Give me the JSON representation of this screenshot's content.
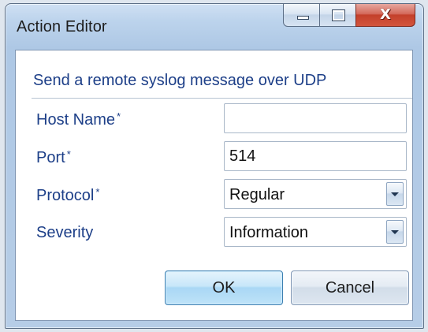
{
  "window": {
    "title": "Action Editor"
  },
  "titlebar_buttons": {
    "minimize_icon": "minimize-icon",
    "maximize_icon": "maximize-icon",
    "close_icon": "close-icon",
    "close_glyph": "X"
  },
  "form": {
    "description": "Send a remote syslog message over UDP",
    "fields": {
      "host_name": {
        "label": "Host Name",
        "required_marker": "*",
        "value": ""
      },
      "port": {
        "label": "Port",
        "required_marker": "*",
        "value": "514"
      },
      "protocol": {
        "label": "Protocol",
        "required_marker": "*",
        "selected": "Regular"
      },
      "severity": {
        "label": "Severity",
        "selected": "Information"
      }
    }
  },
  "buttons": {
    "ok": "OK",
    "cancel": "Cancel"
  },
  "colors": {
    "label_text": "#1d3f88",
    "window_frame": "#b6cde7",
    "close_button": "#c3402b",
    "ok_button": "#a9d7f5"
  }
}
